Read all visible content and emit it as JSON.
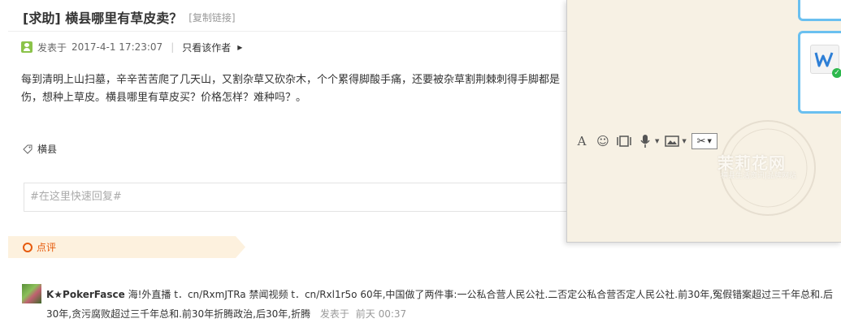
{
  "post": {
    "title": "[求助] 横县哪里有草皮卖？",
    "copy_link": "[复制链接]",
    "posted_label": "发表于",
    "posted_time": "2017-4-1 17:23:07",
    "separator": "|",
    "author_only": "只看该作者",
    "body": "每到清明上山扫墓，辛辛苦苦爬了几天山，又割杂草又砍杂木，个个累得脚酸手痛，还要被杂草割荆棘刺得手脚都是伤，想种上草皮。横县哪里有草皮买？价格怎样？难种吗？。",
    "tag": "横县"
  },
  "reply": {
    "placeholder": "#在这里快速回复#"
  },
  "dianping": {
    "label": "点评"
  },
  "comment": {
    "username": "K★PokerFasce",
    "text": "海!外直播 t．cn/RxmJTRa 禁闻视频 t．cn/Rxl1r5o 60年,中国做了两件事:一公私合营人民公社.二否定公私合营否定人民公社.前30年,冤假错案超过三千年总和.后30年,贪污腐败超过三千年总和.前30年折腾政治,后30年,折腾",
    "posted_label": "发表于",
    "time": "前天 00:37"
  },
  "chat": {
    "toolbar": [
      "font-icon",
      "emoji-icon",
      "screenshot-frame-icon",
      "mic-icon",
      "image-icon",
      "scissors-icon"
    ],
    "accent_color": "#6ac0f0"
  },
  "watermark": {
    "text": "茉莉花网",
    "sub": "横县生活资讯|品牌网站"
  }
}
